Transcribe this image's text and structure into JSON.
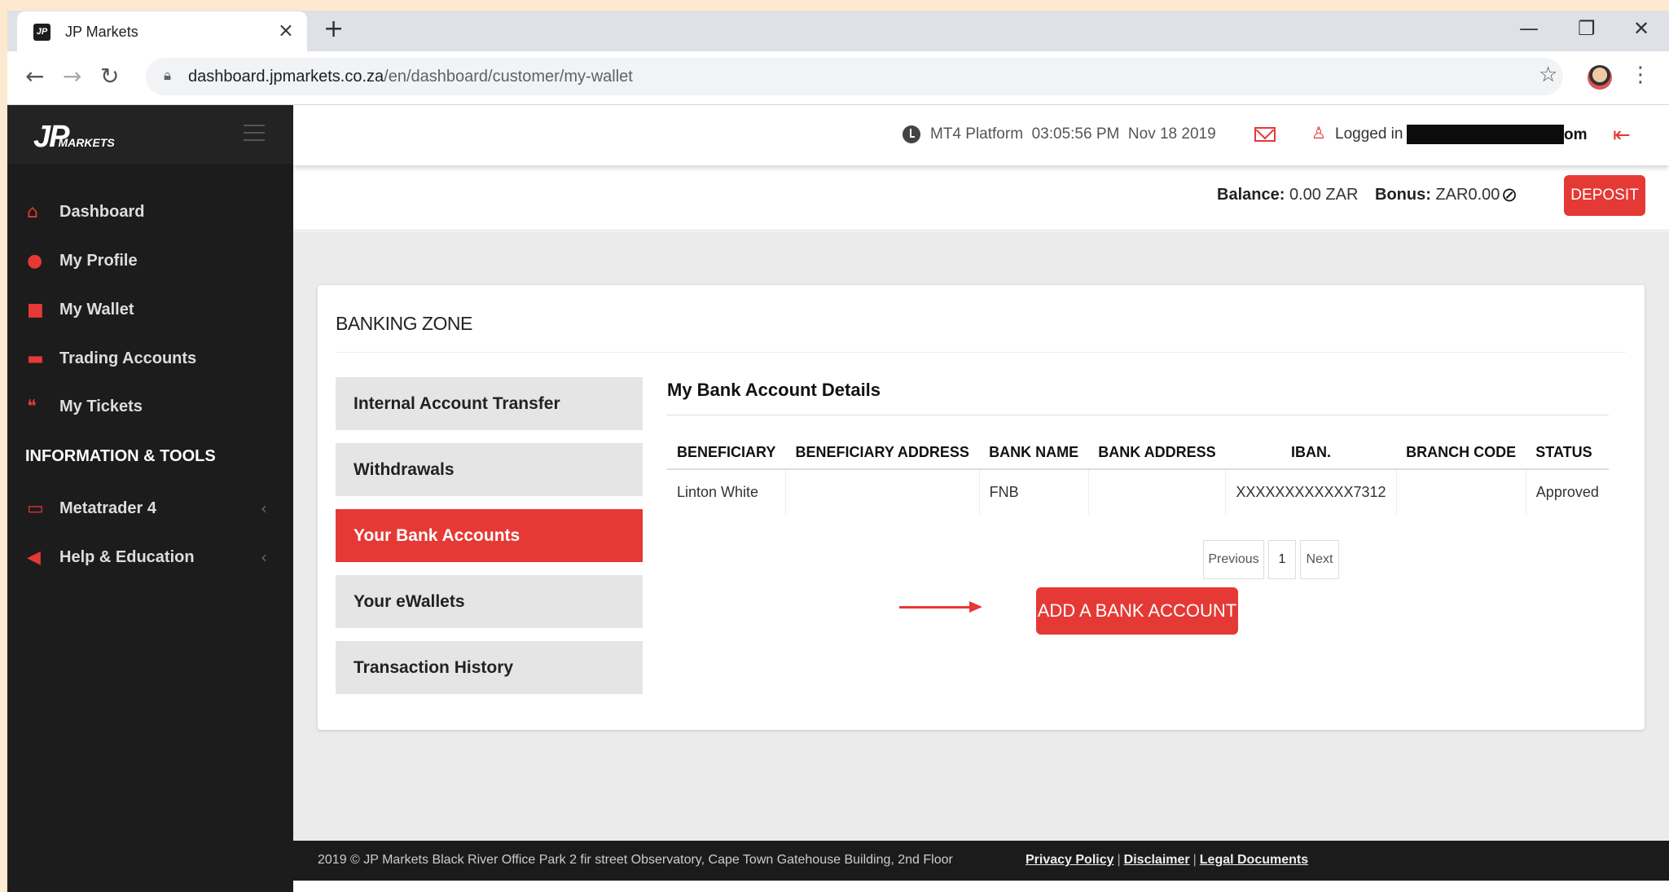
{
  "browser": {
    "tab_title": "JP Markets",
    "favicon_text": "JP",
    "tab_close": "×",
    "new_tab": "+",
    "url_domain": "dashboard.jpmarkets.co.za",
    "url_path": "/en/dashboard/customer/my-wallet",
    "minimize": "—",
    "restore": "❐",
    "close": "✕"
  },
  "sidebar": {
    "logo_text": "JP",
    "logo_sub": "MARKETS",
    "items": [
      {
        "label": "Dashboard",
        "icon": "home-icon"
      },
      {
        "label": "My Profile",
        "icon": "user-icon"
      },
      {
        "label": "My Wallet",
        "icon": "folder-icon"
      },
      {
        "label": "Trading Accounts",
        "icon": "briefcase-icon"
      },
      {
        "label": "My Tickets",
        "icon": "comments-icon"
      }
    ],
    "section_heading": "INFORMATION & TOOLS",
    "tools": [
      {
        "label": "Metatrader 4",
        "icon": "laptop-icon"
      },
      {
        "label": "Help & Education",
        "icon": "megaphone-icon"
      }
    ]
  },
  "header": {
    "platform": "MT4 Platform",
    "time": "03:05:56 PM",
    "date": "Nov 18 2019",
    "logged_in": "Logged in",
    "email_tail": "om"
  },
  "balance": {
    "balance_label": "Balance:",
    "balance_value": "0.00 ZAR",
    "bonus_label": "Bonus:",
    "bonus_value": "ZAR0.00",
    "deposit_label": "DEPOSIT"
  },
  "banking": {
    "title": "BANKING ZONE",
    "menu": [
      "Internal Account Transfer",
      "Withdrawals",
      "Your Bank Accounts",
      "Your eWallets",
      "Transaction History"
    ],
    "active_menu": "Your Bank Accounts",
    "section_title": "My Bank Account Details",
    "columns": [
      "BENEFICIARY",
      "BENEFICIARY ADDRESS",
      "BANK NAME",
      "BANK ADDRESS",
      "IBAN.",
      "BRANCH CODE",
      "STATUS"
    ],
    "rows": [
      {
        "beneficiary": "Linton White",
        "beneficiary_address": "",
        "bank_name": "FNB",
        "bank_address": "",
        "iban": "XXXXXXXXXXXX7312",
        "branch_code": "",
        "status": "Approved"
      }
    ],
    "pagination": {
      "previous": "Previous",
      "page": "1",
      "next": "Next"
    },
    "add_button": "ADD A BANK ACCOUNT"
  },
  "footer": {
    "text": "2019 © JP Markets Black River Office Park 2 fir street Observatory, Cape Town Gatehouse Building, 2nd Floor",
    "links": [
      "Privacy Policy",
      "Disclaimer",
      "Legal Documents"
    ]
  },
  "colors": {
    "accent": "#e53935",
    "sidebar": "#1c1c1c",
    "approved": "#2e7d32"
  }
}
